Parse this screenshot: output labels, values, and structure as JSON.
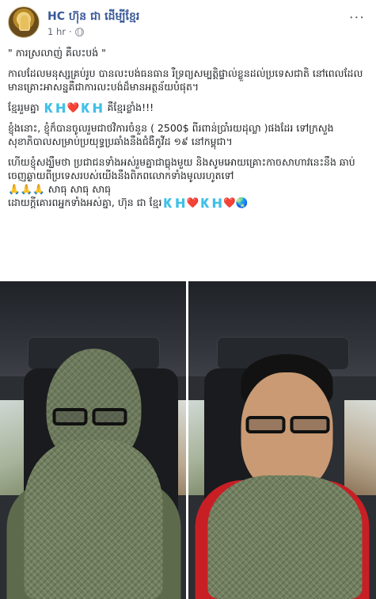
{
  "header": {
    "author": "HC ហ៊ុន ជា ដើម្បីខ្មែរ",
    "timestamp": "1 hr",
    "separator": "·",
    "privacy_icon": "globe-icon",
    "menu_label": "···"
  },
  "post": {
    "paragraphs": [
      "\" ការស្រលាញ់ គឺលះបង់ \"",
      "កាលដែលមនុស្សគ្រប់រូប បានលះបង់ធនធាន រឺទ្រព្យសម្បត្តិផ្ទាល់ខ្លួនដល់ប្រទេសជាតិ នៅពេលដែលមានគ្រោះអាសន្នគឺជាការលះបង់ដ៏មានអត្ថន័យបំផុត។",
      "ខ្មែររួមគ្នា 🇰🇭❤️🇰🇭 គឺខ្មែរខ្លាំង!!!",
      "ខ្ញុំងនោះ, ខ្ញុំក៏បានចូលរួមជាថវិការចំនួន ( 2500$ ពីរពាន់ប្រាំរយដុល្លា )ផងដែរ ទៅក្រសួងសុខាភិបាលសម្រាប់ប្រយុទ្ធប្រឆាំងនឹងជំងឺកូវីដ ១៩ នៅកម្ពុជា។",
      "ហើយខ្ញុំសង្ឃឹមថា ប្រជាជនទាំងអស់រួមគ្នាជាធ្លុងមួយ និងសូមអោយគ្រោះកាចសាហាវនេះនឹង ឆាប់ចេញឆ្ងាយពីប្រទេសរបស់យើងនឹងពិភពលោកទាំងមូលរហូតទៅ",
      "🙏🙏🙏 សាធុ សាធុ សាធុ",
      "ដោយក្តីគោរពអ្នកទាំងអស់គ្នា, ហ៊ុន ជា ខ្មែរ🇰🇭❤️🇰🇭❤️🌏"
    ]
  },
  "photos": {
    "left": {
      "subject": "person-with-scarf-covering-face"
    },
    "right": {
      "subject": "person-with-glasses-and-scarf"
    }
  },
  "colors": {
    "author_link": "#385898",
    "meta_text": "#606770",
    "scarf_green": "#72805f",
    "shirt_red": "#c81f25"
  }
}
